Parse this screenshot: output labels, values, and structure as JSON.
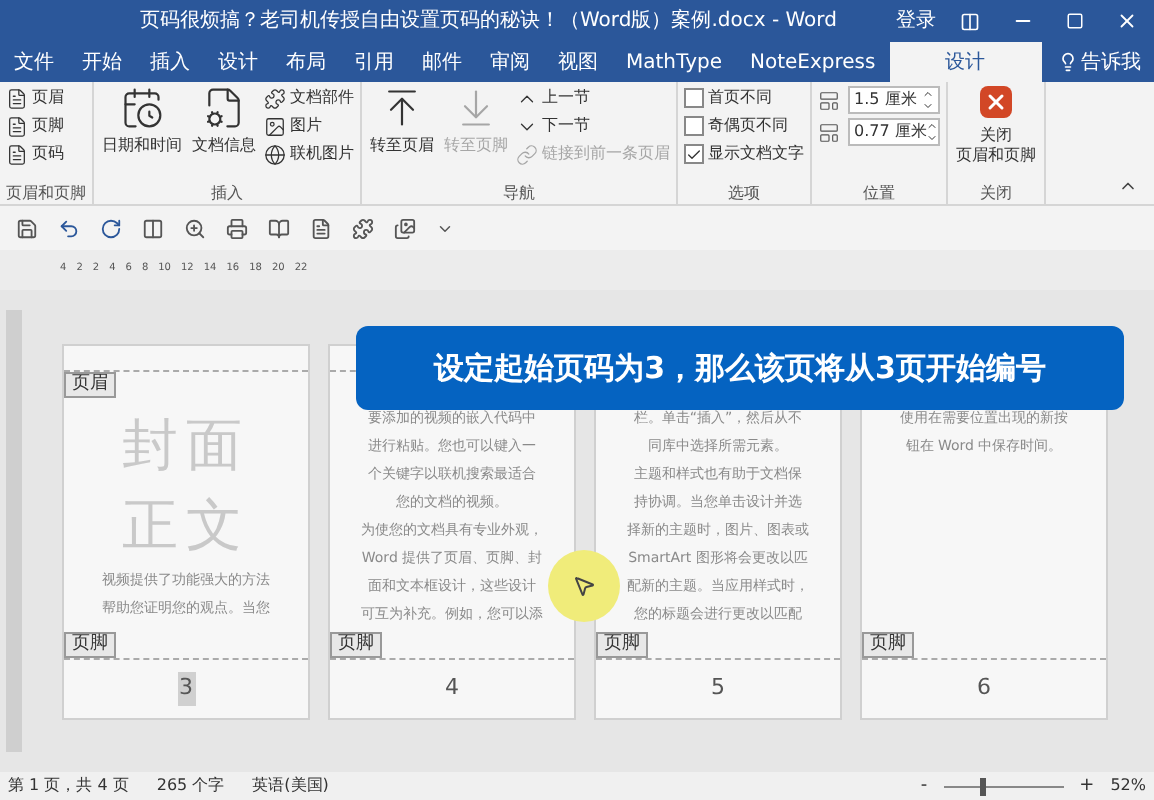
{
  "window": {
    "title": "页码很烦搞？老司机传授自由设置页码的秘诀！（Word版）案例.docx - Word",
    "sign_in": "登录"
  },
  "tabs": [
    {
      "label": "文件",
      "selected": false
    },
    {
      "label": "开始",
      "selected": false
    },
    {
      "label": "插入",
      "selected": false
    },
    {
      "label": "设计",
      "selected": false
    },
    {
      "label": "布局",
      "selected": false
    },
    {
      "label": "引用",
      "selected": false
    },
    {
      "label": "邮件",
      "selected": false
    },
    {
      "label": "审阅",
      "selected": false
    },
    {
      "label": "视图",
      "selected": false
    },
    {
      "label": "MathType",
      "selected": false
    },
    {
      "label": "NoteExpress",
      "selected": false
    },
    {
      "label": "设计",
      "selected": true
    }
  ],
  "tell_me": "告诉我",
  "ribbon_groups": [
    {
      "label": "页眉和页脚",
      "items": [
        {
          "kind": "small",
          "label": "页眉",
          "disabled": false
        },
        {
          "kind": "small",
          "label": "页脚",
          "disabled": false
        },
        {
          "kind": "small",
          "label": "页码",
          "disabled": false
        }
      ]
    },
    {
      "label": "插入",
      "items": [
        {
          "kind": "large",
          "label": "日期和时间",
          "disabled": false
        },
        {
          "kind": "large",
          "label": "文档信息",
          "disabled": false
        },
        {
          "kind": "small",
          "label": "文档部件",
          "disabled": false
        },
        {
          "kind": "small",
          "label": "图片",
          "disabled": false
        },
        {
          "kind": "small",
          "label": "联机图片",
          "disabled": false
        }
      ]
    },
    {
      "label": "导航",
      "items": [
        {
          "kind": "large",
          "label": "转至页眉",
          "disabled": false
        },
        {
          "kind": "large",
          "label": "转至页脚",
          "disabled": true
        },
        {
          "kind": "small",
          "label": "上一节",
          "disabled": false
        },
        {
          "kind": "small",
          "label": "下一节",
          "disabled": false
        },
        {
          "kind": "small",
          "label": "链接到前一条页眉",
          "disabled": true
        }
      ]
    },
    {
      "label": "选项",
      "items": [
        {
          "kind": "check",
          "label": "首页不同",
          "checked": false
        },
        {
          "kind": "check",
          "label": "奇偶页不同",
          "checked": false
        },
        {
          "kind": "check",
          "label": "显示文档文字",
          "checked": true
        }
      ]
    },
    {
      "label": "位置",
      "items": [
        {
          "kind": "spin",
          "label": "1.5 厘米"
        },
        {
          "kind": "spin",
          "label": "0.77 厘米"
        }
      ]
    },
    {
      "label": "关闭",
      "items": [
        {
          "kind": "close",
          "label": "关闭",
          "label2": "页眉和页脚"
        }
      ]
    }
  ],
  "ruler": [
    "4",
    "2",
    "2",
    "4",
    "6",
    "8",
    "10",
    "12",
    "14",
    "16",
    "18",
    "20",
    "22"
  ],
  "callout": "设定起始页码为3，那么该页将从3页开始编号",
  "pages": [
    {
      "cover": [
        "封面",
        "正文"
      ],
      "header_tag": "页眉",
      "lines": [
        "视频提供了功能强大的方法",
        "帮助您证明您的观点。当您"
      ],
      "footer_tag": "页脚",
      "number": "3"
    },
    {
      "lines": [
        "要添加的视频的嵌入代码中",
        "进行粘贴。您也可以键入一",
        "个关键字以联机搜索最适合",
        "您的文档的视频。",
        "为使您的文档具有专业外观，",
        "Word 提供了页眉、页脚、封",
        "面和文本框设计，这些设计",
        "可互为补充。例如，您可以添"
      ],
      "footer_tag": "页脚",
      "number": "4"
    },
    {
      "lines": [
        "栏。单击“插入”，然后从不",
        "同库中选择所需元素。",
        "主题和样式也有助于文档保",
        "持协调。当您单击设计并选",
        "择新的主题时，图片、图表或",
        "SmartArt 图形将会更改以匹",
        "配新的主题。当应用样式时，",
        "您的标题会进行更改以匹配"
      ],
      "footer_tag": "页脚",
      "number": "5"
    },
    {
      "lines": [
        "使用在需要位置出现的新按",
        "钮在 Word 中保存时间。"
      ],
      "footer_tag": "页脚",
      "number": "6"
    }
  ],
  "status_bar": {
    "page": "第 1 页，共 4 页",
    "words": "265 个字",
    "language": "英语(美国)",
    "zoom": "52%",
    "zoom_out": "-",
    "zoom_in": "+",
    "zoom_slider": {
      "level": 0.3
    }
  }
}
